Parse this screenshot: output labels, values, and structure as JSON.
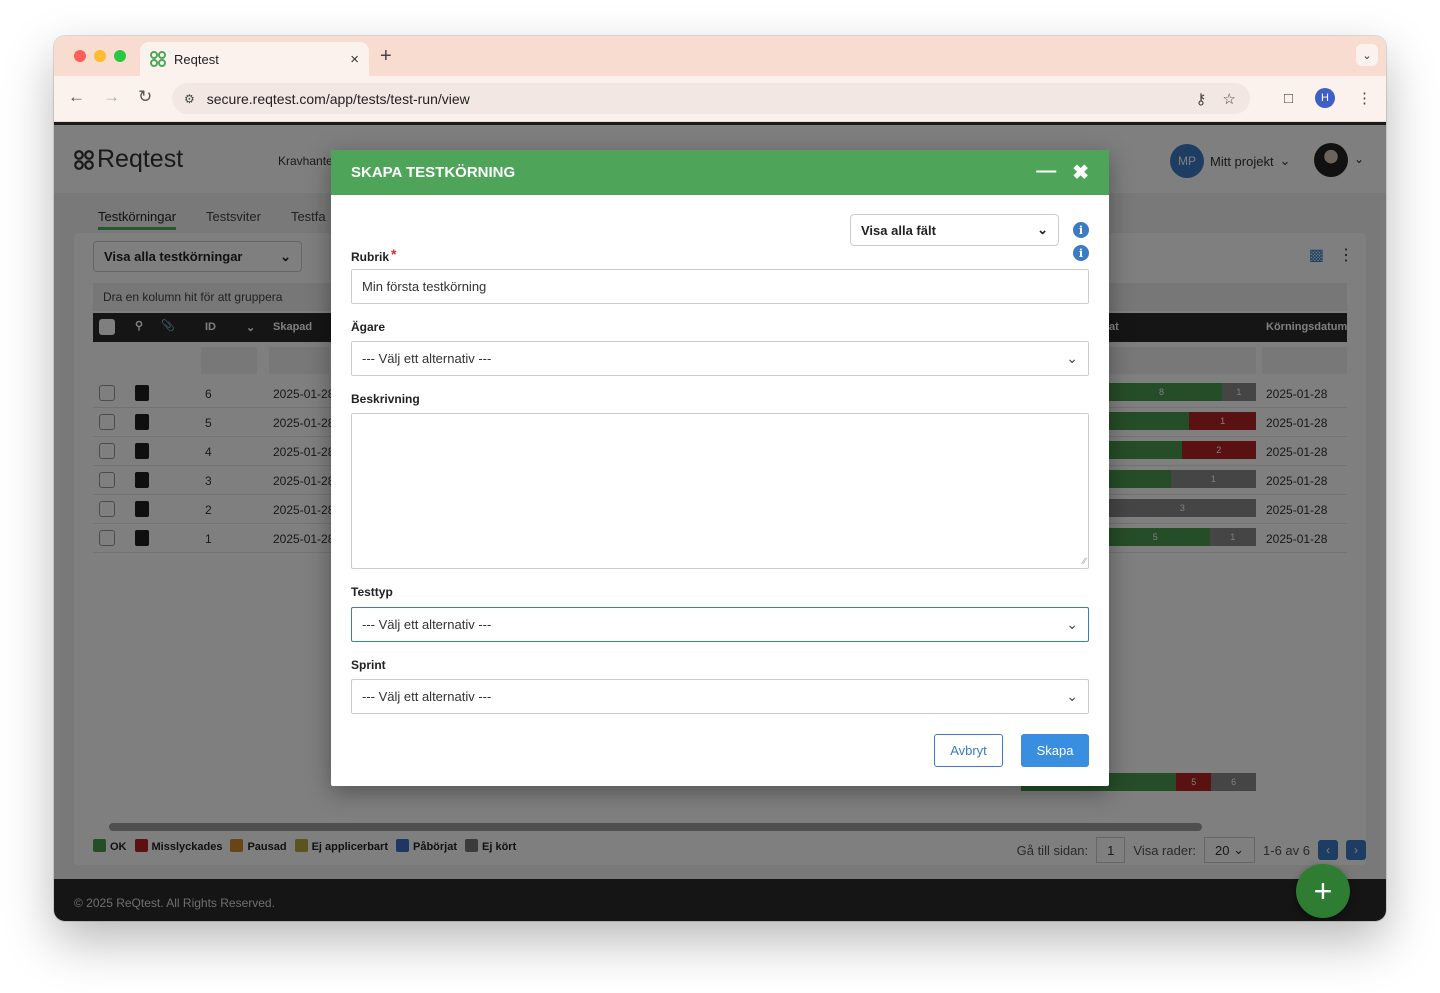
{
  "browser": {
    "tab_title": "Reqtest",
    "tab_close": "×",
    "new_tab": "+",
    "url": "secure.reqtest.com/app/tests/test-run/view",
    "profile_initial": "H"
  },
  "app": {
    "logo_text": "Reqtest",
    "main_nav_partial": "Kravhante",
    "project_initials": "MP",
    "project_name": "Mitt projekt",
    "subtabs": [
      "Testkörningar",
      "Testsviter",
      "Testfa"
    ],
    "view_select": "Visa alla testkörningar",
    "group_hint": "Dra en kolumn hit för att gruppera",
    "columns": {
      "id": "ID",
      "created": "Skapad",
      "status_partial": "at",
      "run_date": "Körningsdatum"
    },
    "rows": [
      {
        "id": "6",
        "created": "2025-01-28",
        "run_date": "2025-01-28",
        "bar": [
          {
            "label": "8",
            "color": "#4a9a4f",
            "frac": 0.78
          },
          {
            "label": "1",
            "color": "#8a8a8a",
            "frac": 0.22
          }
        ]
      },
      {
        "id": "5",
        "created": "2025-01-28",
        "run_date": "2025-01-28",
        "bar": [
          {
            "label": "",
            "color": "#4a9a4f",
            "frac": 0.57
          },
          {
            "label": "1",
            "color": "#b22222",
            "frac": 0.43
          }
        ]
      },
      {
        "id": "4",
        "created": "2025-01-28",
        "run_date": "2025-01-28",
        "bar": [
          {
            "label": "",
            "color": "#4a9a4f",
            "frac": 0.52
          },
          {
            "label": "2",
            "color": "#b22222",
            "frac": 0.48
          }
        ]
      },
      {
        "id": "3",
        "created": "2025-01-28",
        "run_date": "2025-01-28",
        "bar": [
          {
            "label": "",
            "color": "#4a9a4f",
            "frac": 0.45
          },
          {
            "label": "1",
            "color": "#8a8a8a",
            "frac": 0.55
          }
        ]
      },
      {
        "id": "2",
        "created": "2025-01-28",
        "run_date": "2025-01-28",
        "bar": [
          {
            "label": "",
            "color": "#b22222",
            "frac": 0.05
          },
          {
            "label": "3",
            "color": "#8a8a8a",
            "frac": 0.95
          }
        ]
      },
      {
        "id": "1",
        "created": "2025-01-28",
        "run_date": "2025-01-28",
        "bar": [
          {
            "label": "5",
            "color": "#4a9a4f",
            "frac": 0.7
          },
          {
            "label": "1",
            "color": "#8a8a8a",
            "frac": 0.3
          }
        ]
      }
    ],
    "summary_bar": [
      {
        "label": "",
        "color": "#4a9a4f",
        "frac": 0.66
      },
      {
        "label": "5",
        "color": "#b22222",
        "frac": 0.15
      },
      {
        "label": "6",
        "color": "#8a8a8a",
        "frac": 0.19
      }
    ],
    "legend": [
      {
        "label": "OK",
        "color": "#4a9a4f"
      },
      {
        "label": "Misslyckades",
        "color": "#b22222"
      },
      {
        "label": "Pausad",
        "color": "#d08a2c"
      },
      {
        "label": "Ej applicerbart",
        "color": "#b5a93a"
      },
      {
        "label": "Påbörjat",
        "color": "#3a6cc4"
      },
      {
        "label": "Ej kört",
        "color": "#777777"
      }
    ],
    "pager": {
      "goto_label": "Gå till sidan:",
      "page": "1",
      "rows_label": "Visa rader:",
      "rows": "20",
      "range": "1-6 av 6"
    },
    "footer": "© 2025 ReQtest. All Rights Reserved."
  },
  "modal": {
    "title": "SKAPA TESTKÖRNING",
    "show_fields": "Visa alla fält",
    "rubrik_label": "Rubrik",
    "rubrik_value": "Min första testkörning",
    "owner_label": "Ägare",
    "owner_value": "--- Välj ett alternativ ---",
    "desc_label": "Beskrivning",
    "testtype_label": "Testtyp",
    "testtype_value": "--- Välj ett alternativ ---",
    "sprint_label": "Sprint",
    "sprint_value": "--- Välj ett alternativ ---",
    "cancel": "Avbryt",
    "create": "Skapa"
  }
}
